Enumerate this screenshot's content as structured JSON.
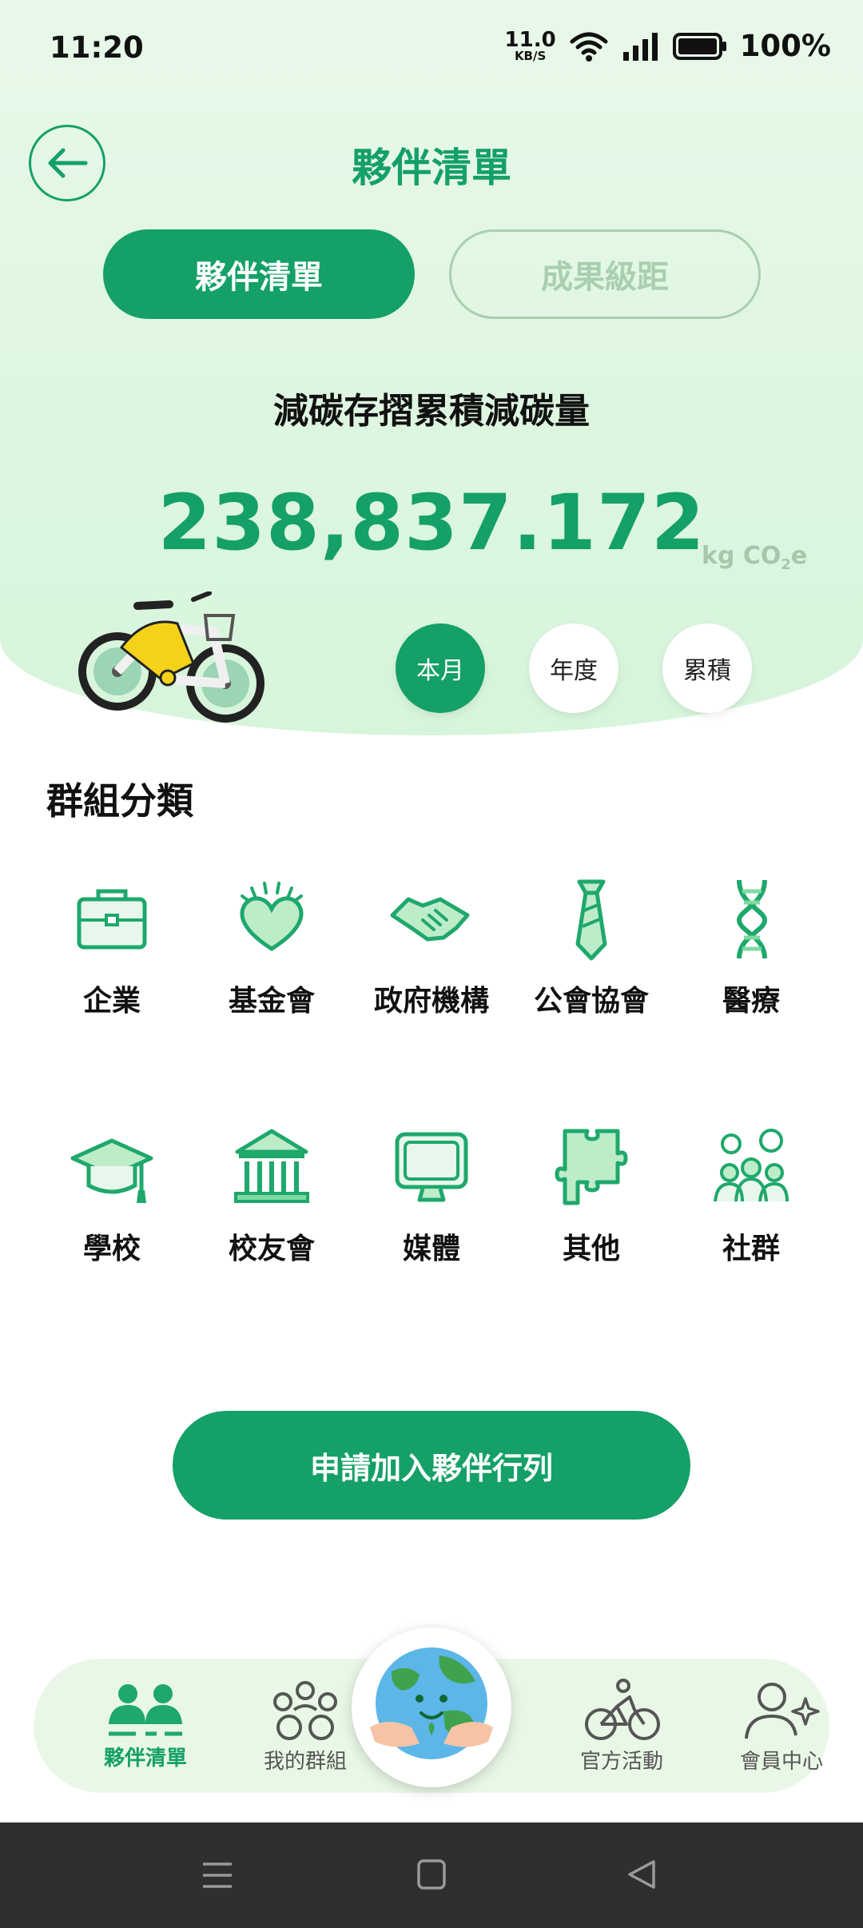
{
  "status_bar": {
    "time": "11:20",
    "speed_value": "11.0",
    "speed_unit": "KB/S",
    "battery": "100%"
  },
  "header": {
    "title": "夥伴清單"
  },
  "segment": {
    "active": "夥伴清單",
    "inactive": "成果級距"
  },
  "summary": {
    "label": "減碳存摺累積減碳量",
    "value": "238,837.172",
    "unit_prefix": "kg CO",
    "unit_sub": "2",
    "unit_suffix": "e"
  },
  "periods": [
    {
      "label": "本月",
      "active": true
    },
    {
      "label": "年度",
      "active": false
    },
    {
      "label": "累積",
      "active": false
    }
  ],
  "groups": {
    "title": "群組分類",
    "items": [
      {
        "label": "企業",
        "icon": "briefcase-icon"
      },
      {
        "label": "基金會",
        "icon": "heart-hands-icon"
      },
      {
        "label": "政府機構",
        "icon": "handshake-icon"
      },
      {
        "label": "公會協會",
        "icon": "tie-icon"
      },
      {
        "label": "醫療",
        "icon": "dna-icon"
      },
      {
        "label": "學校",
        "icon": "graduation-cap-icon"
      },
      {
        "label": "校友會",
        "icon": "institution-icon"
      },
      {
        "label": "媒體",
        "icon": "monitor-icon"
      },
      {
        "label": "其他",
        "icon": "puzzle-icon"
      },
      {
        "label": "社群",
        "icon": "community-icon"
      }
    ]
  },
  "cta": {
    "label": "申請加入夥伴行列"
  },
  "tabbar": {
    "tabs": [
      {
        "label": "夥伴清單",
        "active": true
      },
      {
        "label": "我的群組",
        "active": false
      },
      {
        "label": "官方活動",
        "active": false
      },
      {
        "label": "會員中心",
        "active": false
      }
    ]
  },
  "colors": {
    "primary": "#14a067",
    "hero_bg": "#e9f8e9",
    "muted": "#a9cfae"
  }
}
